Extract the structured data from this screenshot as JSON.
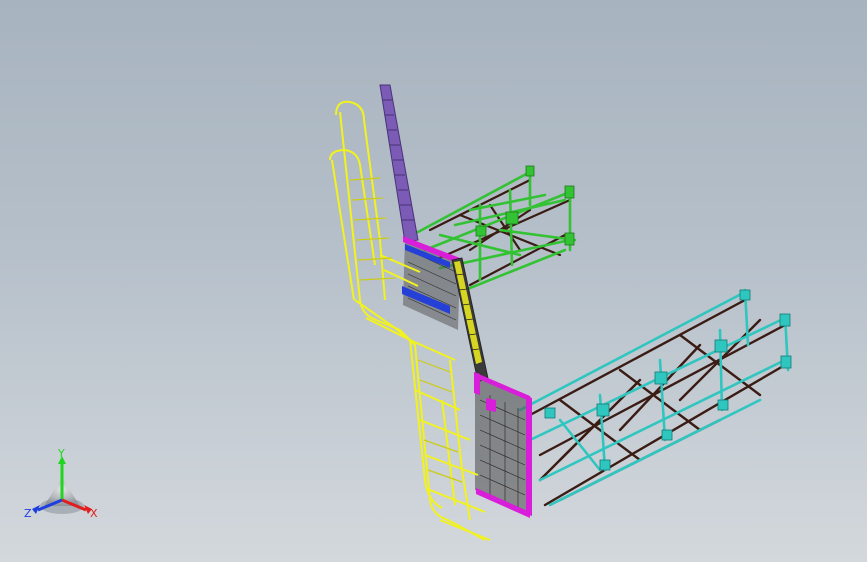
{
  "viewport": {
    "background_top": "#a7b3bf",
    "background_bottom": "#d3d8dc"
  },
  "model": {
    "handrail_color": "#f2f21e",
    "ladder_color": "#7b5bb5",
    "platform_edge_color": "#d81ed8",
    "blue_beam_color": "#2540d6",
    "upper_truss_color": "#33c233",
    "lower_truss_color": "#2fc6c0",
    "brace_color": "#3b1c14",
    "grating_color": "#2a2a2a"
  },
  "triad": {
    "y_label": "Y",
    "x_label": "X",
    "z_label": "Z",
    "y_color": "#1fd61f",
    "x_color": "#e01e1e",
    "z_color": "#1e3ee0"
  }
}
